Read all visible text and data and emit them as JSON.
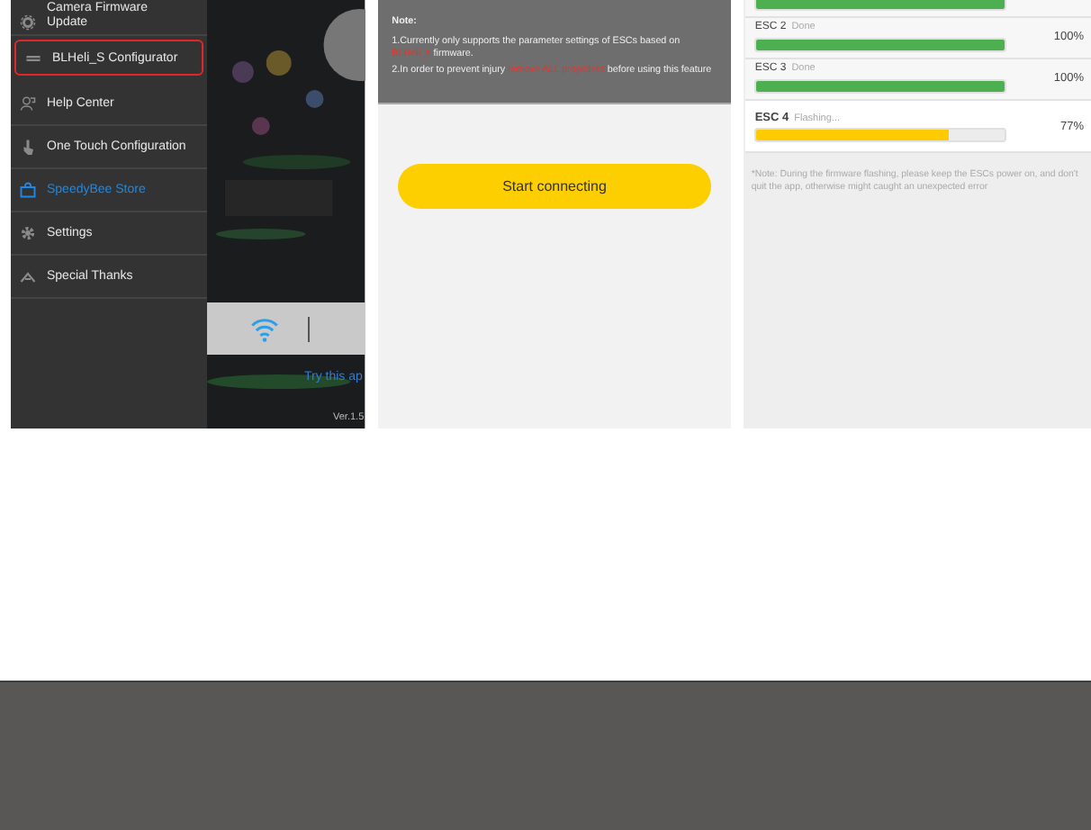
{
  "screens": [
    {
      "menu": [
        {
          "label": "Camera Firmware Update",
          "selected": false,
          "outlined": false
        },
        {
          "label": "BLHeli_S Configurator",
          "selected": false,
          "outlined": true
        },
        {
          "label": "Help Center",
          "selected": false,
          "outlined": false
        },
        {
          "label": "One Touch Configuration",
          "selected": false,
          "outlined": false
        },
        {
          "label": "SpeedyBee Store",
          "selected": true,
          "outlined": false
        },
        {
          "label": "Settings",
          "selected": false,
          "outlined": false
        },
        {
          "label": "Special Thanks",
          "selected": false,
          "outlined": false
        }
      ],
      "link": "Try this ap",
      "version": "Ver.1.5"
    },
    {
      "note_title": "Note:",
      "note_lines": [
        [
          {
            "text": "1.Currently only supports the parameter settings of ESCs based on ",
            "kind": "plain"
          },
          {
            "text": "BLHeli_s",
            "kind": "warning"
          },
          {
            "text": " firmware.",
            "kind": "plain"
          }
        ],
        [
          {
            "text": "2.In order to prevent injury ",
            "kind": "plain"
          },
          {
            "text": "remove ALL propellers",
            "kind": "warning"
          },
          {
            "text": " before using this feature",
            "kind": "plain"
          }
        ]
      ],
      "button": "Start connecting"
    },
    {
      "escs": [
        {
          "level": 1,
          "flashing": false
        },
        {
          "name": "ESC 2",
          "status": "Done",
          "level": 1,
          "reading": "100%",
          "flashing": false
        },
        {
          "name": "ESC 3",
          "status": "Done",
          "level": 1,
          "reading": "100%",
          "flashing": false
        },
        {
          "name": "ESC 4",
          "status": "Flashing...",
          "level": 0.77,
          "reading": "77%",
          "flashing": true
        }
      ],
      "footnote": "*Note: During the firmware flashing, please keep the ESCs power on, and don't quit the app, otherwise might caught an unexpected error"
    }
  ]
}
